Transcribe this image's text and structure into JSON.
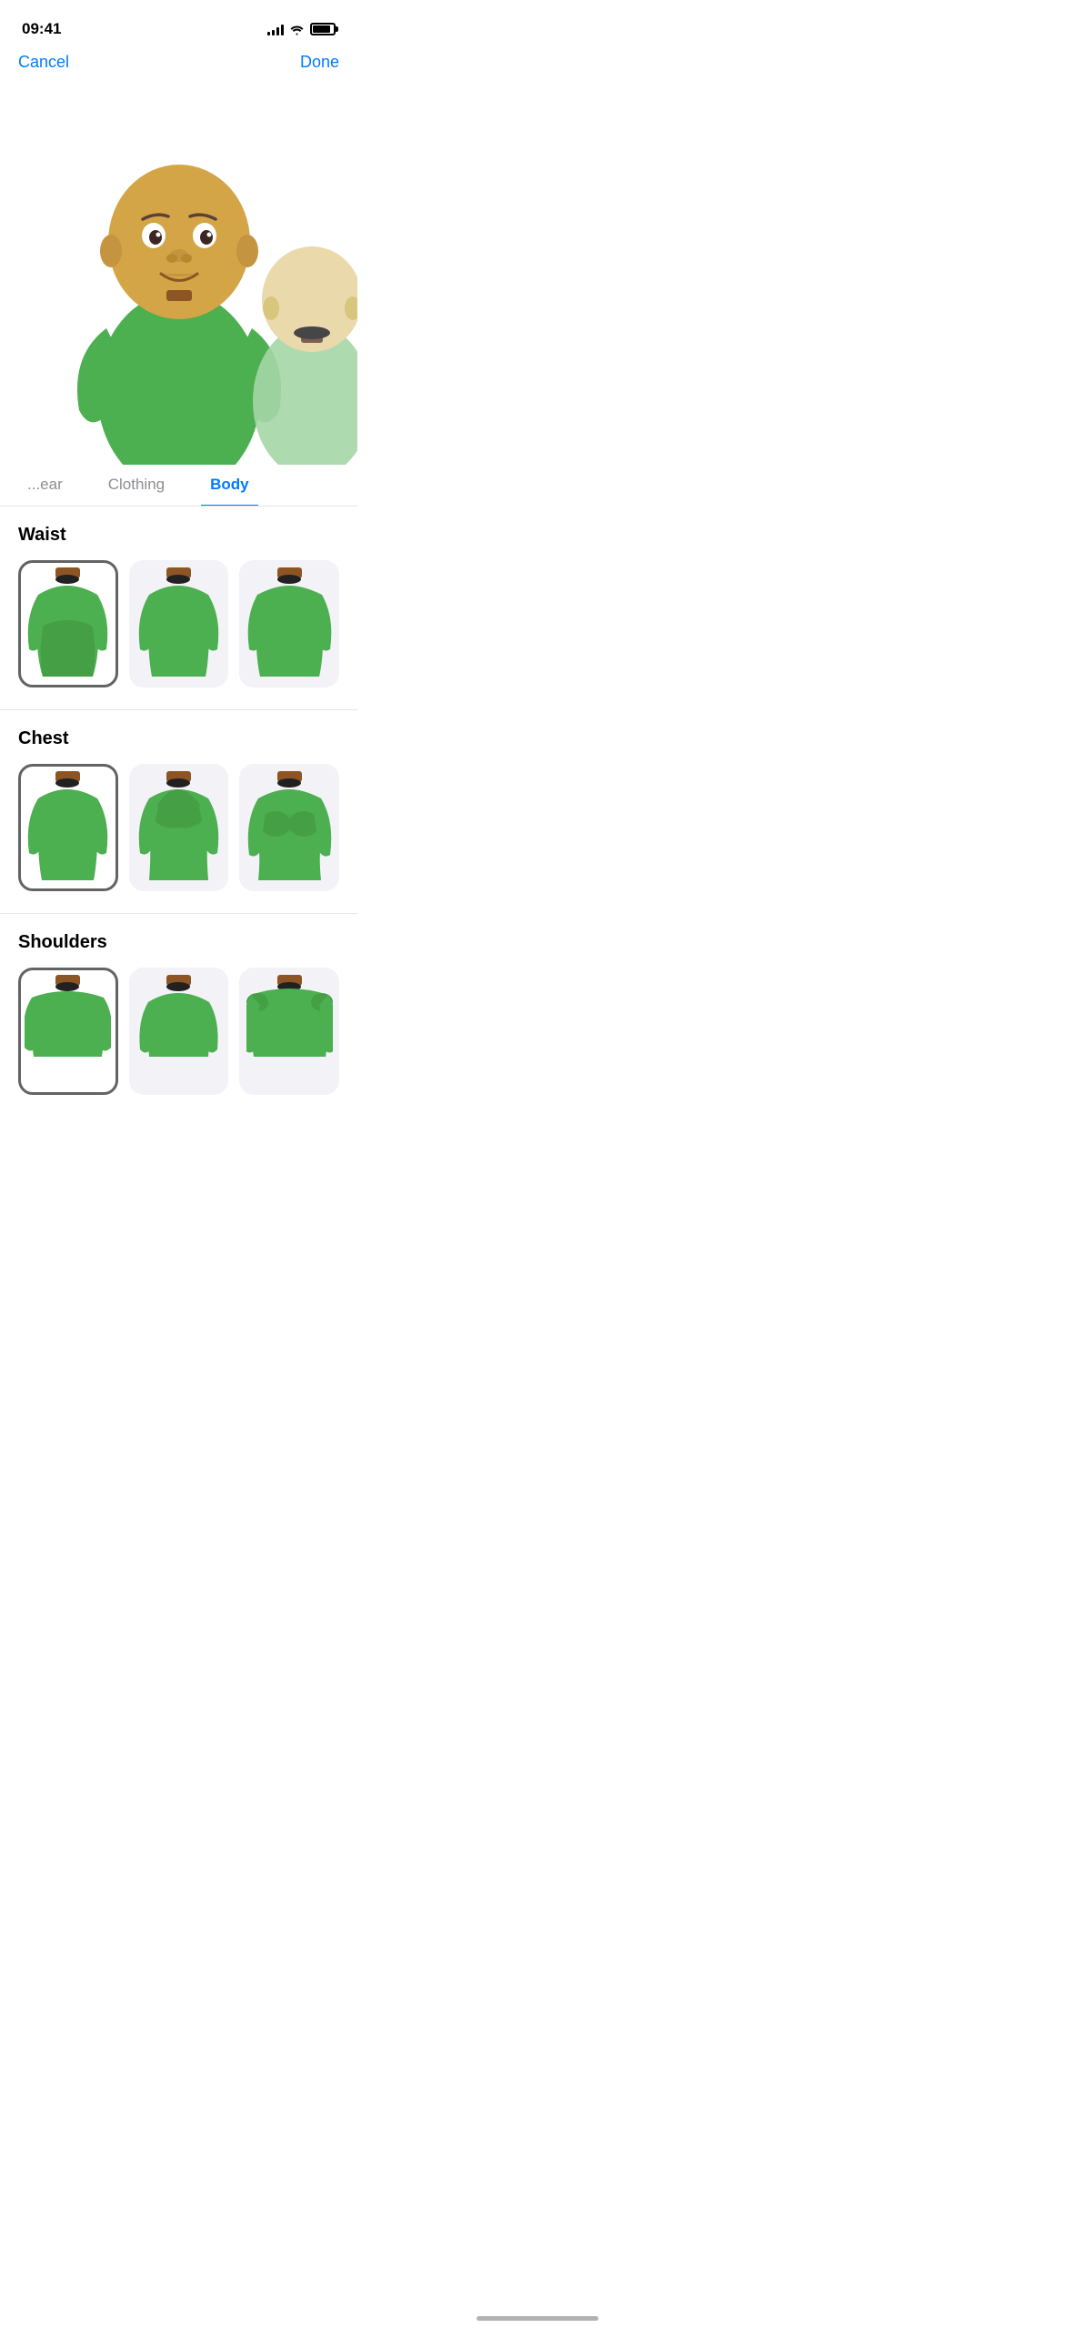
{
  "statusBar": {
    "time": "09:41",
    "battery": 85
  },
  "nav": {
    "cancelLabel": "Cancel",
    "doneLabel": "Done"
  },
  "tabs": [
    {
      "id": "headwear",
      "label": "ear",
      "active": false
    },
    {
      "id": "clothing",
      "label": "Clothing",
      "active": false
    },
    {
      "id": "body",
      "label": "Body",
      "active": true
    }
  ],
  "sections": [
    {
      "id": "waist",
      "title": "Waist",
      "options": [
        {
          "id": "waist-1",
          "selected": true
        },
        {
          "id": "waist-2",
          "selected": false
        },
        {
          "id": "waist-3",
          "selected": false
        }
      ]
    },
    {
      "id": "chest",
      "title": "Chest",
      "options": [
        {
          "id": "chest-1",
          "selected": true
        },
        {
          "id": "chest-2",
          "selected": false
        },
        {
          "id": "chest-3",
          "selected": false
        }
      ]
    },
    {
      "id": "shoulders",
      "title": "Shoulders",
      "options": [
        {
          "id": "shoulders-1",
          "selected": true
        },
        {
          "id": "shoulders-2",
          "selected": false
        },
        {
          "id": "shoulders-3",
          "selected": false
        }
      ]
    }
  ]
}
